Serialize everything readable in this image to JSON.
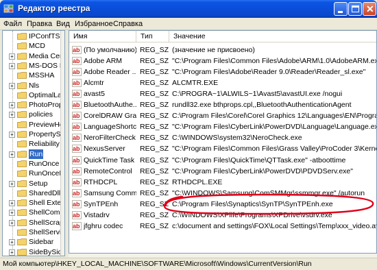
{
  "window": {
    "title": "Редактор реестра",
    "icon": "regedit-icon"
  },
  "menu": [
    "Файл",
    "Правка",
    "Вид",
    "Избранное",
    "Справка"
  ],
  "tree": {
    "items": [
      {
        "label": "IPConfTSP",
        "expandable": false
      },
      {
        "label": "MCD",
        "expandable": false
      },
      {
        "label": "Media Cen",
        "expandable": true
      },
      {
        "label": "MS-DOS Er",
        "expandable": true
      },
      {
        "label": "MSSHA",
        "expandable": false
      },
      {
        "label": "Nls",
        "expandable": true
      },
      {
        "label": "OptimalLay",
        "expandable": false
      },
      {
        "label": "PhotoProp",
        "expandable": true
      },
      {
        "label": "policies",
        "expandable": true
      },
      {
        "label": "PreviewHe",
        "expandable": false
      },
      {
        "label": "PropertySy",
        "expandable": true
      },
      {
        "label": "Reliability",
        "expandable": false
      },
      {
        "label": "Run",
        "expandable": true,
        "selected": true
      },
      {
        "label": "RunOnce",
        "expandable": false
      },
      {
        "label": "RunOnceE",
        "expandable": false
      },
      {
        "label": "Setup",
        "expandable": true
      },
      {
        "label": "SharedDlls",
        "expandable": false
      },
      {
        "label": "Shell Exter",
        "expandable": true
      },
      {
        "label": "ShellComp",
        "expandable": true
      },
      {
        "label": "ShellScrap",
        "expandable": true
      },
      {
        "label": "ShellServic",
        "expandable": false
      },
      {
        "label": "Sidebar",
        "expandable": true
      },
      {
        "label": "SideBySide",
        "expandable": true
      }
    ]
  },
  "list": {
    "columns": [
      "Имя",
      "Тип",
      "Значение"
    ],
    "rows": [
      {
        "name": "(По умолчанию)",
        "type": "REG_SZ",
        "data": "(значение не присвоено)"
      },
      {
        "name": "Adobe ARM",
        "type": "REG_SZ",
        "data": "\"C:\\Program Files\\Common Files\\Adobe\\ARM\\1.0\\AdobeARM.exe\""
      },
      {
        "name": "Adobe Reader ...",
        "type": "REG_SZ",
        "data": "\"C:\\Program Files\\Adobe\\Reader 9.0\\Reader\\Reader_sl.exe\""
      },
      {
        "name": "Alcmtr",
        "type": "REG_SZ",
        "data": "ALCMTR.EXE"
      },
      {
        "name": "avast5",
        "type": "REG_SZ",
        "data": "C:\\PROGRA~1\\ALWILS~1\\Avast5\\avastUI.exe /nogui"
      },
      {
        "name": "BluetoothAuthe...",
        "type": "REG_SZ",
        "data": "rundll32.exe bthprops.cpl,,BluetoothAuthenticationAgent"
      },
      {
        "name": "CorelDRAW Gra...",
        "type": "REG_SZ",
        "data": "C:\\Program Files\\Corel\\Corel Graphics 12\\Languages\\EN\\Programs\\Regis"
      },
      {
        "name": "LanguageShortcut",
        "type": "REG_SZ",
        "data": "\"C:\\Program Files\\CyberLink\\PowerDVD\\Language\\Language.exe\""
      },
      {
        "name": "NeroFilterCheck",
        "type": "REG_SZ",
        "data": "C:\\WINDOWS\\system32\\NeroCheck.exe"
      },
      {
        "name": "NexusServer",
        "type": "REG_SZ",
        "data": "\"C:\\Program Files\\Common Files\\Grass Valley\\ProCoder 3\\Kernel\\PNXSER"
      },
      {
        "name": "QuickTime Task",
        "type": "REG_SZ",
        "data": "\"C:\\Program Files\\QuickTime\\QTTask.exe\" -atboottime"
      },
      {
        "name": "RemoteControl",
        "type": "REG_SZ",
        "data": "\"C:\\Program Files\\CyberLink\\PowerDVD\\PDVDServ.exe\""
      },
      {
        "name": "RTHDCPL",
        "type": "REG_SZ",
        "data": "RTHDCPL.EXE"
      },
      {
        "name": "Samsung Comm...",
        "type": "REG_SZ",
        "data": "\"C:\\WINDOWS\\Samsung\\ComSMMgr\\ssmmgr.exe\" /autorun"
      },
      {
        "name": "SynTPEnh",
        "type": "REG_SZ",
        "data": "C:\\Program Files\\Synaptics\\SynTP\\SynTPEnh.exe"
      },
      {
        "name": "Vistadrv",
        "type": "REG_SZ",
        "data": "C:\\WINDOWS\\XPlife\\Programs\\XPDrive\\vsdrv.exe"
      },
      {
        "name": "jfghru codec",
        "type": "REG_SZ",
        "data": "c:\\document and settings\\FOX\\Local Settings\\Temp\\xxx_video.avi.exe"
      }
    ]
  },
  "status": {
    "path": "Мой компьютер\\HKEY_LOCAL_MACHINE\\SOFTWARE\\Microsoft\\Windows\\CurrentVersion\\Run"
  },
  "colors": {
    "titlebar": "#0a4ed8",
    "selection": "#316ac5",
    "annotation": "#e0001a",
    "folder": "#f4d36b"
  }
}
